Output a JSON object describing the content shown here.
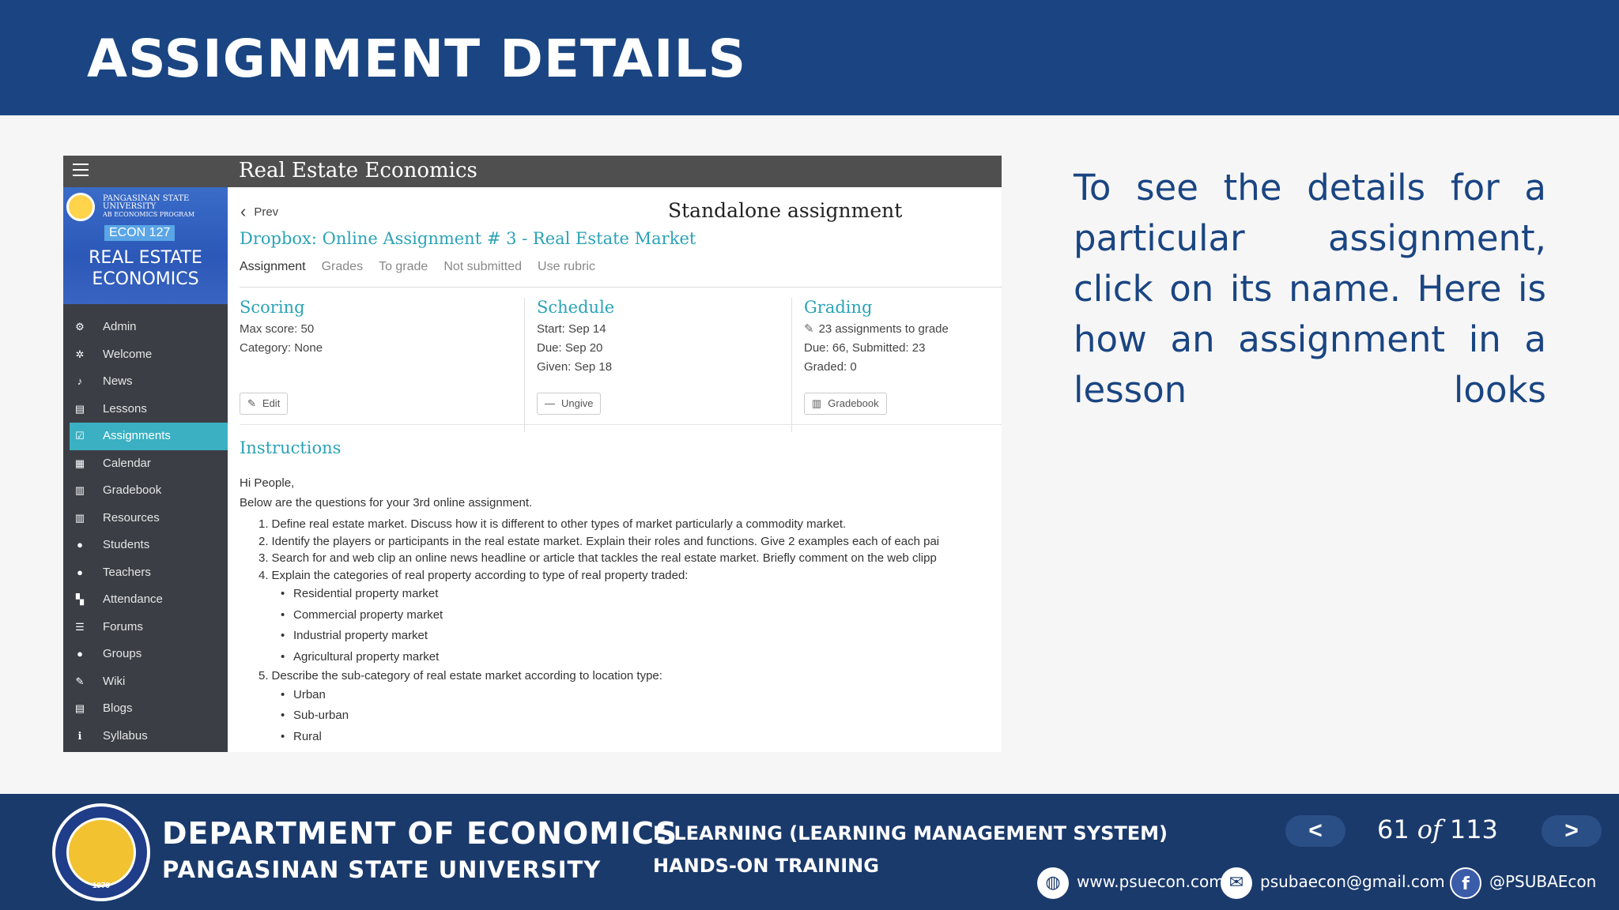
{
  "slide": {
    "title": "ASSIGNMENT DETAILS",
    "explanation": "To see the details for a particular assignment, click on its name. Here is how an assignment in a lesson looks"
  },
  "lms": {
    "course_title": "Real Estate Economics",
    "banner": {
      "university": "PANGASINAN STATE UNIVERSITY",
      "program": "AB ECONOMICS PROGRAM",
      "code": "ECON 127",
      "name_line1": "REAL ESTATE",
      "name_line2": "ECONOMICS"
    },
    "nav": [
      {
        "label": "Admin",
        "icon": "gear-icon",
        "glyph": "⚙"
      },
      {
        "label": "Welcome",
        "icon": "sparkle-icon",
        "glyph": "✲"
      },
      {
        "label": "News",
        "icon": "bell-icon",
        "glyph": "♪"
      },
      {
        "label": "Lessons",
        "icon": "book-icon",
        "glyph": "▤"
      },
      {
        "label": "Assignments",
        "icon": "checkbox-icon",
        "glyph": "☑",
        "active": true
      },
      {
        "label": "Calendar",
        "icon": "calendar-icon",
        "glyph": "▦"
      },
      {
        "label": "Gradebook",
        "icon": "gradebook-icon",
        "glyph": "▥"
      },
      {
        "label": "Resources",
        "icon": "resources-icon",
        "glyph": "▥"
      },
      {
        "label": "Students",
        "icon": "user-icon",
        "glyph": "●"
      },
      {
        "label": "Teachers",
        "icon": "teacher-icon",
        "glyph": "●"
      },
      {
        "label": "Attendance",
        "icon": "attendance-icon",
        "glyph": "▚"
      },
      {
        "label": "Forums",
        "icon": "list-icon",
        "glyph": "☰"
      },
      {
        "label": "Groups",
        "icon": "groups-icon",
        "glyph": "●"
      },
      {
        "label": "Wiki",
        "icon": "edit-icon",
        "glyph": "✎"
      },
      {
        "label": "Blogs",
        "icon": "blog-icon",
        "glyph": "▤"
      },
      {
        "label": "Syllabus",
        "icon": "info-icon",
        "glyph": "ℹ"
      }
    ],
    "content": {
      "prev_label": "Prev",
      "page_heading": "Standalone assignment",
      "assignment_name": "Dropbox: Online Assignment # 3 - Real Estate Market",
      "tabs": [
        "Assignment",
        "Grades",
        "To grade",
        "Not submitted",
        "Use rubric"
      ],
      "scoring": {
        "heading": "Scoring",
        "max_score": "Max score: 50",
        "category": "Category: None",
        "button": "Edit"
      },
      "schedule": {
        "heading": "Schedule",
        "start": "Start: Sep 14",
        "due": "Due: Sep 20",
        "given": "Given: Sep 18",
        "button": "Ungive"
      },
      "grading": {
        "heading": "Grading",
        "to_grade_link": "23 assignments to grade",
        "due_submitted": "Due: 66, Submitted: 23",
        "graded": "Graded: 0",
        "button": "Gradebook"
      },
      "instructions": {
        "heading": "Instructions",
        "greeting": "Hi People,",
        "intro": "Below are the questions for your 3rd online assignment.",
        "items": [
          {
            "n": "1.",
            "text": "Define real estate market. Discuss how it is different to other types of market particularly a commodity market."
          },
          {
            "n": "2.",
            "text": "Identify the players or participants in the real estate market. Explain their roles and functions. Give 2 examples each of each pai"
          },
          {
            "n": "3.",
            "text": "Search for and web clip an online news headline or article that tackles the real estate market. Briefly comment on the web clipp"
          },
          {
            "n": "4.",
            "text": "Explain the categories of real property according to type of real property traded:",
            "sub": [
              "Residential property market",
              "Commercial property market",
              "Industrial property market",
              "Agricultural property market"
            ]
          },
          {
            "n": "5.",
            "text": "Describe the sub-category of real estate market according to location type:",
            "sub": [
              "Urban",
              "Sub-urban",
              "Rural"
            ]
          }
        ]
      }
    }
  },
  "footer": {
    "dept": "DEPARTMENT OF ECONOMICS",
    "university": "PANGASINAN STATE UNIVERSITY",
    "seal_year": "1979",
    "course_line1": "E-LEARNING (LEARNING MANAGEMENT SYSTEM)",
    "course_line2": "HANDS-ON TRAINING",
    "page_current": "61",
    "page_of": "of",
    "page_total": "113",
    "website": "www.psuecon.com",
    "email": "psubaecon@gmail.com",
    "facebook": "@PSUBAEcon"
  },
  "colors": {
    "header_blue": "#1a4582",
    "footer_blue": "#1a3a6c",
    "accent_teal": "#2aa3b6",
    "sidebar": "#3b3e45",
    "active_nav": "#3ab0c2"
  }
}
